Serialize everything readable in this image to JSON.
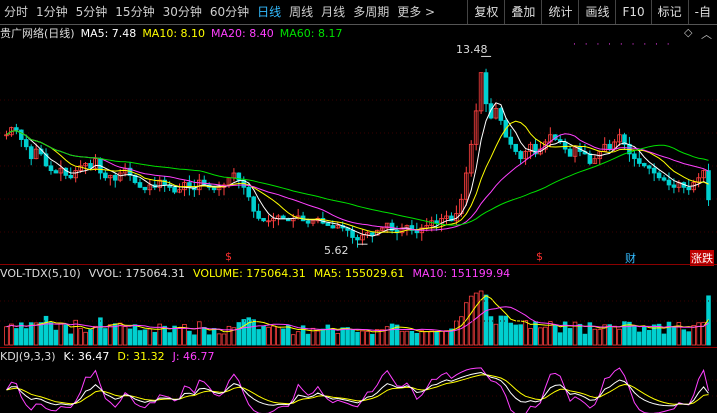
{
  "toolbar": {
    "tabs": [
      "分时",
      "1分钟",
      "5分钟",
      "15分钟",
      "30分钟",
      "60分钟",
      "日线",
      "周线",
      "月线",
      "多周期",
      "更多 >"
    ],
    "active_tab": "日线",
    "right_buttons": [
      "复权",
      "叠加",
      "统计",
      "画线",
      "F10",
      "标记",
      "-自"
    ]
  },
  "main_info": {
    "title": "贵广网络(日线)",
    "ma5": "MA5: 7.48",
    "ma10": "MA10: 8.10",
    "ma20": "MA20: 8.40",
    "ma60": "MA60: 8.17"
  },
  "price_annotations": {
    "high": "13.48",
    "low": "5.62"
  },
  "event_markers": {
    "dollar1": "$",
    "dollar2": "$",
    "cai": "财",
    "zhangdie": "涨跌"
  },
  "vol_info": {
    "label": "VOL-TDX(5,10)",
    "vvol": "VVOL: 175064.31",
    "volume": "VOLUME: 175064.31",
    "ma5": "MA5: 155029.61",
    "ma10": "MA10: 151199.94"
  },
  "kdj_info": {
    "label": "KDJ(9,3,3)",
    "k": "K: 36.47",
    "d": "D: 31.32",
    "j": "J: 46.77"
  },
  "colors": {
    "up": "#ff4040",
    "down": "#00d0d0",
    "ma5": "#ffffff",
    "ma10": "#ffff00",
    "ma20": "#ff40ff",
    "ma60": "#00e000",
    "accent": "#33bbff"
  },
  "chart_data": {
    "type": "candlestick",
    "close": [
      10.2,
      10.5,
      10.4,
      10.0,
      9.7,
      9.2,
      9.6,
      9.4,
      8.9,
      8.7,
      8.6,
      8.8,
      8.5,
      8.4,
      8.7,
      8.9,
      9.0,
      8.8,
      9.2,
      8.6,
      8.4,
      8.5,
      8.3,
      8.6,
      8.8,
      8.5,
      8.2,
      8.0,
      7.9,
      8.1,
      8.0,
      8.3,
      8.1,
      8.0,
      7.8,
      7.9,
      8.2,
      8.0,
      7.9,
      8.3,
      8.1,
      8.0,
      7.9,
      8.0,
      8.1,
      8.4,
      8.6,
      8.3,
      8.0,
      7.6,
      7.0,
      6.7,
      6.6,
      6.6,
      6.7,
      6.8,
      6.7,
      6.6,
      6.7,
      6.8,
      6.6,
      6.5,
      6.6,
      6.7,
      6.5,
      6.4,
      6.3,
      6.4,
      6.3,
      6.2,
      5.9,
      5.8,
      6.0,
      6.1,
      6.0,
      6.2,
      6.3,
      6.5,
      6.2,
      6.1,
      6.3,
      6.4,
      6.2,
      6.1,
      6.3,
      6.4,
      6.6,
      6.5,
      6.7,
      6.8,
      6.6,
      6.9,
      7.5,
      8.6,
      9.8,
      11.2,
      12.8,
      11.5,
      10.9,
      11.3,
      10.8,
      10.1,
      9.8,
      9.5,
      9.2,
      9.5,
      9.8,
      9.4,
      9.6,
      9.9,
      10.2,
      10.0,
      9.9,
      9.6,
      9.3,
      9.7,
      9.5,
      9.4,
      9.0,
      9.2,
      9.5,
      9.8,
      9.6,
      9.9,
      10.2,
      9.8,
      9.4,
      9.2,
      9.0,
      8.9,
      8.8,
      8.6,
      8.4,
      8.3,
      8.1,
      8.0,
      8.2,
      8.0,
      7.9,
      8.2,
      8.4,
      8.7,
      7.48
    ],
    "ma5_last": 7.48,
    "ma10_last": 8.1,
    "ma20_last": 8.4,
    "ma60_last": 8.17,
    "high": 13.48,
    "low": 5.62
  }
}
